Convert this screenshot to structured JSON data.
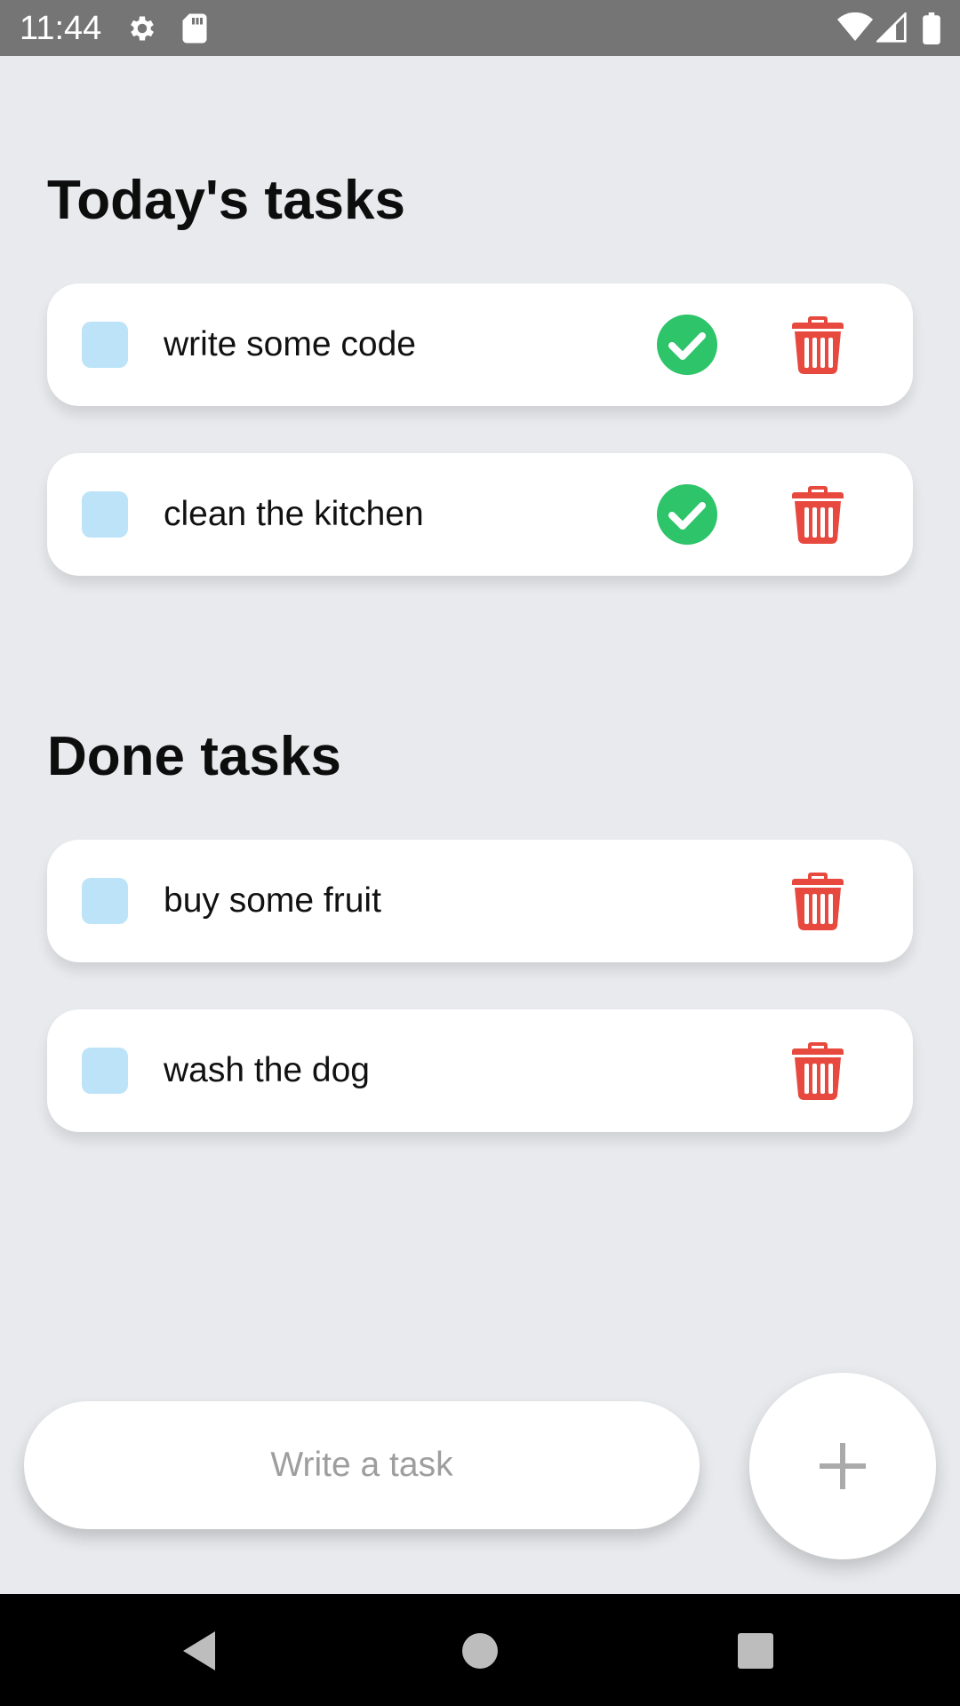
{
  "status_bar": {
    "time": "11:44",
    "icons": [
      "gear-icon",
      "sd-card-icon",
      "wifi-icon",
      "signal-icon",
      "battery-icon"
    ]
  },
  "sections": [
    {
      "title": "Today's tasks",
      "tasks": [
        {
          "label": "write some code",
          "has_complete": true
        },
        {
          "label": "clean the kitchen",
          "has_complete": true
        }
      ]
    },
    {
      "title": "Done tasks",
      "tasks": [
        {
          "label": "buy some fruit",
          "has_complete": false
        },
        {
          "label": "wash the dog",
          "has_complete": false
        }
      ]
    }
  ],
  "input": {
    "placeholder": "Write a task",
    "value": ""
  },
  "add_button": {
    "icon": "plus-icon"
  },
  "nav_bar": {
    "icons": [
      "back-icon",
      "home-icon",
      "recents-icon"
    ]
  },
  "colors": {
    "background": "#e8eaed",
    "checkbox": "#bde3f8",
    "complete_green": "#2dc46a",
    "delete_red": "#e8493f",
    "status_bar": "#757575"
  }
}
